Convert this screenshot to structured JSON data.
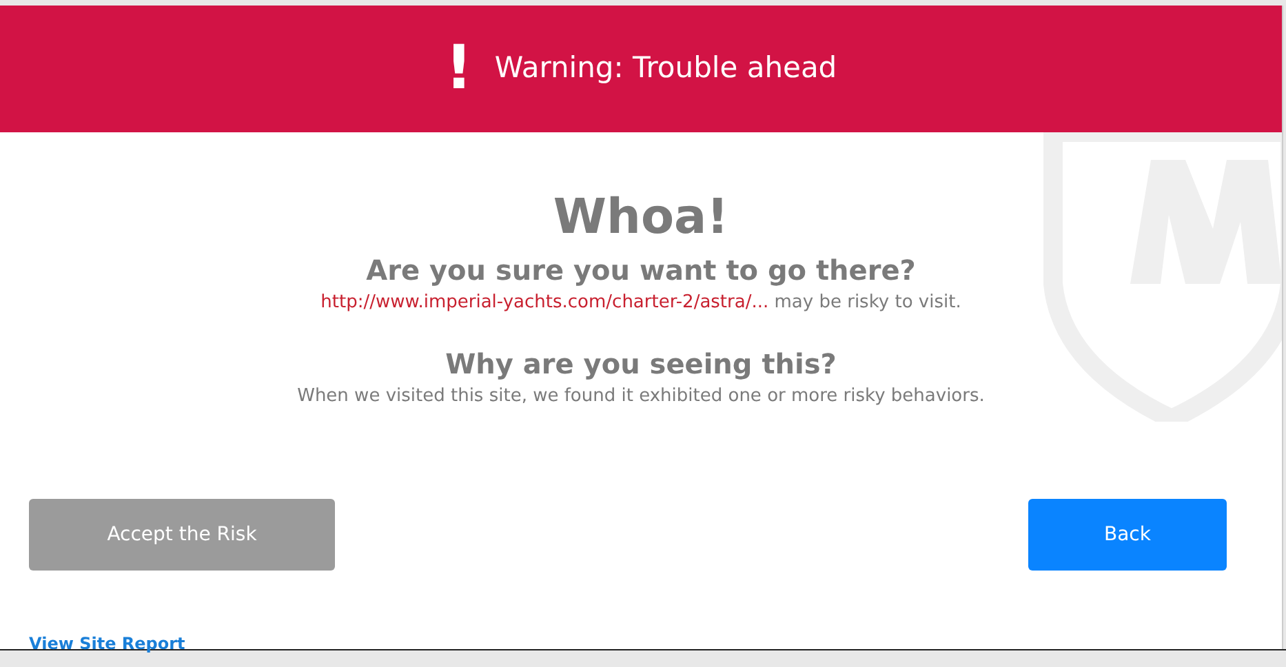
{
  "banner": {
    "icon_text": "!",
    "title": "Warning: Trouble ahead"
  },
  "heading": "Whoa!",
  "question": "Are you sure you want to go there?",
  "url": "http://www.imperial-yachts.com/charter-2/astra/...",
  "url_suffix": "may be risky to visit.",
  "why_heading": "Why are you seeing this?",
  "why_text": "When we visited this site, we found it exhibited one or more risky behaviors.",
  "buttons": [
    {
      "label": "Accept the Risk",
      "kind": "secondary"
    },
    {
      "label": "Back",
      "kind": "primary"
    }
  ],
  "report_link": "View Site Report"
}
